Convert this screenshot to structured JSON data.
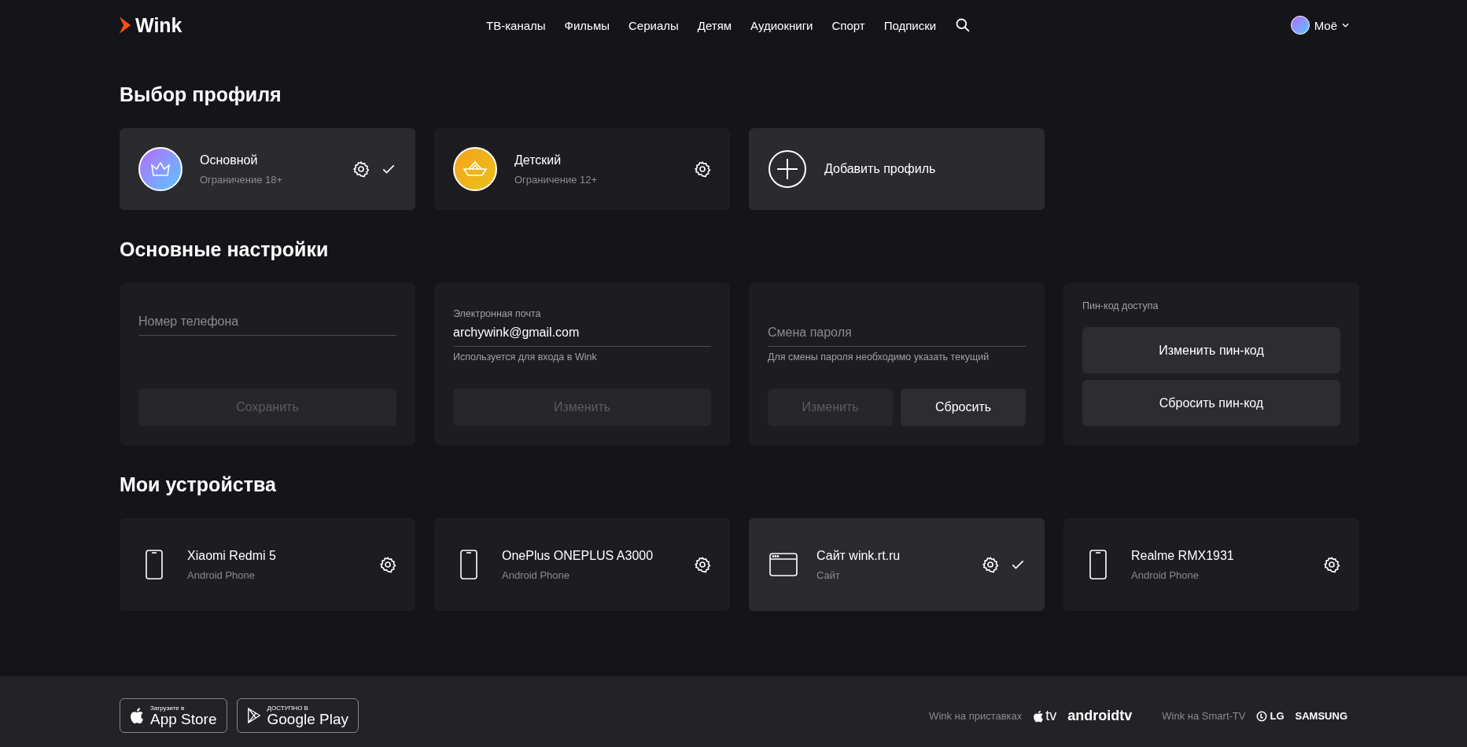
{
  "header": {
    "logo": "Wink",
    "nav": [
      "ТВ-каналы",
      "Фильмы",
      "Сериалы",
      "Детям",
      "Аудиокниги",
      "Спорт",
      "Подписки"
    ],
    "user": "Моё"
  },
  "profiles": {
    "title": "Выбор профиля",
    "items": [
      {
        "kind": "adult",
        "name": "Основной",
        "subtitle": "Ограничение 18+",
        "selected": true
      },
      {
        "kind": "kids",
        "name": "Детский",
        "subtitle": "Ограничение 12+",
        "selected": false
      }
    ],
    "add": "Добавить профиль"
  },
  "settings": {
    "title": "Основные настройки",
    "phone": {
      "placeholder": "Номер телефона",
      "button": {
        "label": "Сохранить",
        "disabled": true
      }
    },
    "email": {
      "label": "Электронная почта",
      "value": "archywink@gmail.com",
      "hint": "Используется для входа в Wink",
      "button": {
        "label": "Изменить",
        "disabled": true
      }
    },
    "password": {
      "placeholder": "Смена пароля",
      "hint": "Для смены пароля необходимо указать текущий",
      "buttons": [
        {
          "label": "Изменить",
          "disabled": true
        },
        {
          "label": "Сбросить",
          "disabled": false
        }
      ]
    },
    "pin": {
      "label": "Пин-код доступа",
      "buttons": [
        {
          "label": "Изменить пин-код",
          "disabled": false
        },
        {
          "label": "Сбросить пин-код",
          "disabled": false
        }
      ]
    }
  },
  "devices": {
    "title": "Мои устройства",
    "items": [
      {
        "kind": "phone",
        "name": "Xiaomi Redmi 5",
        "type": "Android Phone",
        "selected": false
      },
      {
        "kind": "phone",
        "name": "OnePlus ONEPLUS A3000",
        "type": "Android Phone",
        "selected": false
      },
      {
        "kind": "browser",
        "name": "Сайт wink.rt.ru",
        "type": "Сайт",
        "selected": true
      },
      {
        "kind": "phone",
        "name": "Realme RMX1931",
        "type": "Android Phone",
        "selected": false
      }
    ]
  },
  "footer": {
    "stores": [
      {
        "kind": "apple",
        "caption": "Загрузите в",
        "name": "App Store"
      },
      {
        "kind": "google",
        "caption": "ДОСТУПНО В",
        "name": "Google Play"
      }
    ],
    "boxes_label": "Wink на приставках",
    "boxes": [
      "tv",
      "androidtv"
    ],
    "smart_tv_label": "Wink на Smart-TV",
    "tvs": [
      "LG",
      "SAMSUNG"
    ]
  }
}
